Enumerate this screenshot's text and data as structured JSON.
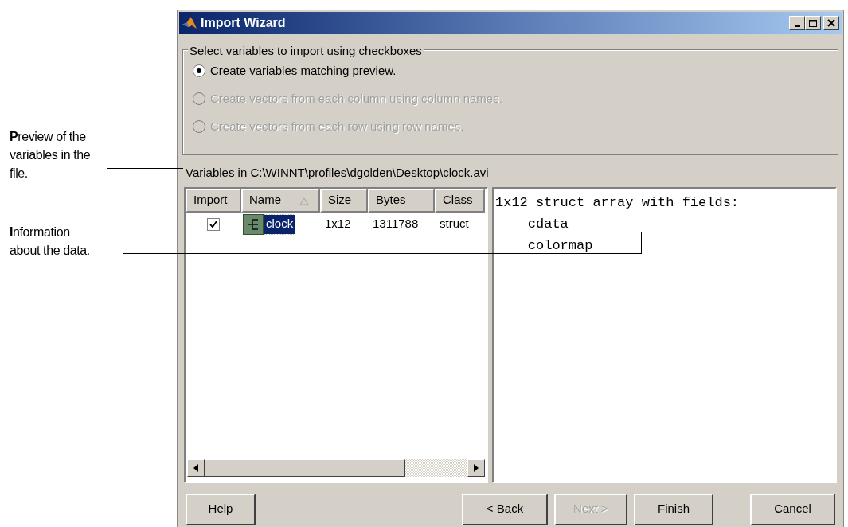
{
  "annotations": [
    {
      "text": "**P**review of the variables in the file."
    },
    {
      "text": "**I**nformation about the data."
    }
  ],
  "window": {
    "title": "Import Wizard"
  },
  "options": {
    "title": "Select variables to import using checkboxes",
    "radios": [
      {
        "label": "Create variables matching preview.",
        "selected": true,
        "disabled": false
      },
      {
        "label": "Create vectors from each column using column names.",
        "selected": false,
        "disabled": true
      },
      {
        "label": "Create vectors from each row using row names.",
        "selected": false,
        "disabled": true
      }
    ]
  },
  "variables_label": "Variables in C:\\WINNT\\profiles\\dgolden\\Desktop\\clock.avi",
  "table": {
    "columns": [
      {
        "label": "Import",
        "sorted": false
      },
      {
        "label": "Name",
        "sorted": true
      },
      {
        "label": "Size",
        "sorted": false
      },
      {
        "label": "Bytes",
        "sorted": false
      },
      {
        "label": "Class",
        "sorted": false
      }
    ],
    "rows": [
      {
        "checked": true,
        "selected": true,
        "name": "clock",
        "size": "1x12",
        "bytes": "1311788",
        "class": "struct"
      }
    ]
  },
  "info": [
    "1x12 struct array with fields:",
    "    cdata",
    "    colormap"
  ],
  "buttons": [
    {
      "label": "Help",
      "disabled": false
    },
    {
      "label": "< Back",
      "disabled": false
    },
    {
      "label": "Next >",
      "disabled": true
    },
    {
      "label": "Finish",
      "disabled": false
    },
    {
      "label": "Cancel",
      "disabled": false
    }
  ]
}
